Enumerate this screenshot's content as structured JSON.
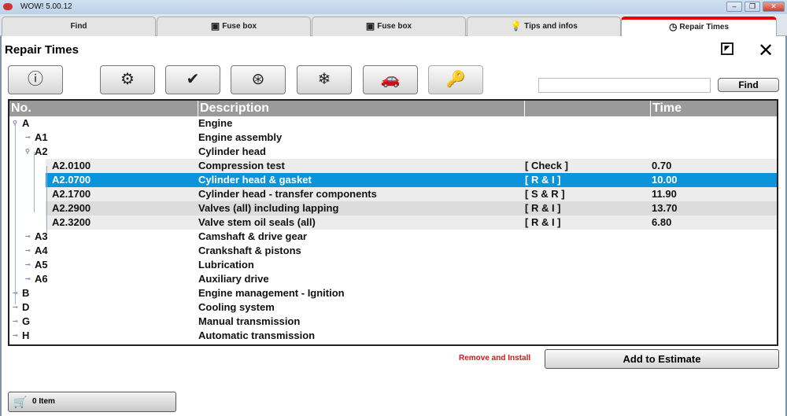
{
  "window": {
    "title": "WOW! 5.00.12"
  },
  "tabs": [
    {
      "label": "Find",
      "icon": ""
    },
    {
      "label": "Fuse box",
      "icon": "fuse-box-icon"
    },
    {
      "label": "Fuse box",
      "icon": "fuse-box-icon"
    },
    {
      "label": "Tips and infos",
      "icon": "lightbulb-icon"
    },
    {
      "label": "Repair Times",
      "icon": "clock-icon",
      "active": true
    }
  ],
  "page": {
    "title": "Repair Times"
  },
  "toolbar": [
    "info-icon",
    "engine-icon",
    "engine-management-icon",
    "steering-wheel-icon",
    "snowflake-icon",
    "car-icon",
    "key-icon"
  ],
  "search": {
    "value": "",
    "button": "Find"
  },
  "table": {
    "headers": [
      "No.",
      "Description",
      "",
      "Time"
    ],
    "rows": [
      {
        "no": "A",
        "desc": "Engine",
        "op": "",
        "time": "",
        "level": 0,
        "expanded": true
      },
      {
        "no": "A1",
        "desc": "Engine assembly",
        "op": "",
        "time": "",
        "level": 1
      },
      {
        "no": "A2",
        "desc": "Cylinder head",
        "op": "",
        "time": "",
        "level": 1,
        "expanded": true
      },
      {
        "no": "A2.0100",
        "desc": "Compression test",
        "op": "[ Check ]",
        "time": "0.70",
        "level": 2
      },
      {
        "no": "A2.0700",
        "desc": "Cylinder head & gasket",
        "op": "[ R & I ]",
        "time": "10.00",
        "level": 2,
        "selected": true
      },
      {
        "no": "A2.1700",
        "desc": "Cylinder head - transfer components",
        "op": "[ S & R ]",
        "time": "11.90",
        "level": 2
      },
      {
        "no": "A2.2900",
        "desc": "Valves (all) including lapping",
        "op": "[ R & I ]",
        "time": "13.70",
        "level": 2
      },
      {
        "no": "A2.3200",
        "desc": "Valve stem oil seals (all)",
        "op": "[ R & I ]",
        "time": "6.80",
        "level": 2
      },
      {
        "no": "A3",
        "desc": "Camshaft & drive gear",
        "op": "",
        "time": "",
        "level": 1
      },
      {
        "no": "A4",
        "desc": "Crankshaft & pistons",
        "op": "",
        "time": "",
        "level": 1
      },
      {
        "no": "A5",
        "desc": "Lubrication",
        "op": "",
        "time": "",
        "level": 1
      },
      {
        "no": "A6",
        "desc": "Auxiliary drive",
        "op": "",
        "time": "",
        "level": 1
      },
      {
        "no": "B",
        "desc": "Engine management - Ignition",
        "op": "",
        "time": "",
        "level": 0
      },
      {
        "no": "D",
        "desc": "Cooling system",
        "op": "",
        "time": "",
        "level": 0
      },
      {
        "no": "G",
        "desc": "Manual transmission",
        "op": "",
        "time": "",
        "level": 0
      },
      {
        "no": "H",
        "desc": "Automatic transmission",
        "op": "",
        "time": "",
        "level": 0
      }
    ]
  },
  "footer": {
    "operation_label": "Remove and Install",
    "add_button": "Add to Estimate",
    "cart_label": "0 Item"
  },
  "colors": {
    "selected": "#0a94dc",
    "active_tab": "#e00000",
    "operation": "#d01818"
  }
}
